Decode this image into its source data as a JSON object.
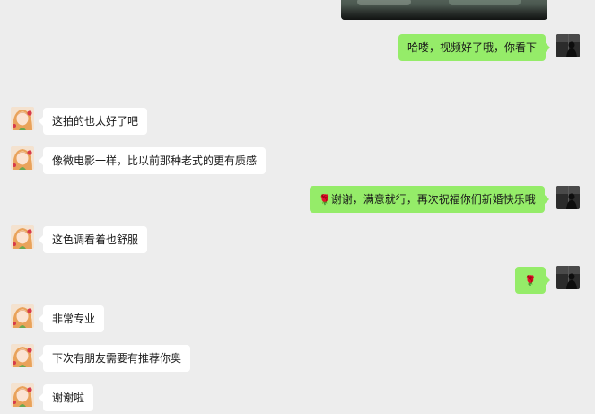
{
  "messages": [
    {
      "from": "me",
      "text": "哈喽，视频好了哦，你看下"
    },
    {
      "from": "friend",
      "text": "这拍的也太好了吧"
    },
    {
      "from": "friend",
      "text": "像微电影一样，比以前那种老式的更有质感"
    },
    {
      "from": "me",
      "emoji": "🌹",
      "text": "谢谢，满意就行，再次祝福你们新婚快乐哦"
    },
    {
      "from": "friend",
      "text": "这色调看着也舒服"
    },
    {
      "from": "me",
      "emoji": "🌹",
      "text": ""
    },
    {
      "from": "friend",
      "text": "非常专业"
    },
    {
      "from": "friend",
      "text": "下次有朋友需要有推荐你奥"
    },
    {
      "from": "friend",
      "text": "谢谢啦"
    }
  ],
  "colors": {
    "background": "#ededed",
    "outgoing_bubble": "#95ec69",
    "incoming_bubble": "#ffffff"
  },
  "icons": {
    "friend_avatar": "anime-girl-avatar-icon",
    "my_avatar": "dark-silhouette-avatar-icon",
    "rose": "rose-emoji-icon"
  }
}
